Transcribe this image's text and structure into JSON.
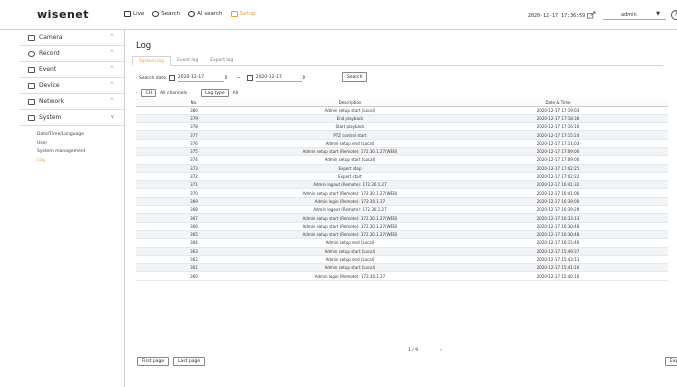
{
  "header": {
    "logo": "wisenet",
    "nav": [
      {
        "label": "Live",
        "icon": "monitor-icon"
      },
      {
        "label": "Search",
        "icon": "search-icon"
      },
      {
        "label": "AI search",
        "icon": "ai-search-icon"
      },
      {
        "label": "Setup",
        "icon": "setup-icon",
        "active": true
      }
    ],
    "datetime": "2020-12-17 17:36:59",
    "user": "admin",
    "help": "?"
  },
  "sidebar": {
    "items": [
      {
        "label": "Camera",
        "icon": "camera-icon"
      },
      {
        "label": "Record",
        "icon": "record-icon"
      },
      {
        "label": "Event",
        "icon": "event-icon"
      },
      {
        "label": "Device",
        "icon": "device-icon"
      },
      {
        "label": "Network",
        "icon": "network-icon"
      },
      {
        "label": "System",
        "icon": "system-icon"
      }
    ],
    "submenu": [
      "Date/Time/Language",
      "User",
      "System management",
      "Log"
    ]
  },
  "main": {
    "title": "Log",
    "tabs": [
      "System log",
      "Event log",
      "Export log"
    ],
    "filter": {
      "label": "Search date",
      "start_date": "2020-12-17",
      "end_date": "2020-12-17",
      "search_button": "Search"
    },
    "channel": {
      "ch_button": "CH",
      "ch_value": "All channels",
      "log_type_button": "Log type",
      "log_type_value": "All"
    },
    "table": {
      "headers": [
        "No.",
        "Description",
        "Date & Time"
      ],
      "rows": [
        [
          "380",
          "Admin setup start (Local)",
          "2020-12-17 17:19:03"
        ],
        [
          "379",
          "End playback",
          "2020-12-17 17:18:38"
        ],
        [
          "378",
          "Start playback",
          "2020-12-17 17:16:16"
        ],
        [
          "377",
          "PTZ control start",
          "2020-12-17 17:15:24"
        ],
        [
          "376",
          "Admin setup end (Local)",
          "2020-12-17 17:11:03"
        ],
        [
          "375",
          "Admin setup start (Remote): 172.30.1.27(WEB)",
          "2020-12-17 17:09:00"
        ],
        [
          "374",
          "Admin setup start (Local)",
          "2020-12-17 17:09:00"
        ],
        [
          "373",
          "Export stop",
          "2020-12-17 17:02:25"
        ],
        [
          "372",
          "Export start",
          "2020-12-17 17:02:22"
        ],
        [
          "371",
          "Admin logout (Remote): 172.30.1.27",
          "2020-12-17 16:41:32"
        ],
        [
          "370",
          "Admin setup start (Remote): 172.30.1.27(WEB)",
          "2020-12-17 16:41:06"
        ],
        [
          "369",
          "Admin login (Remote): 172.30.1.27",
          "2020-12-17 16:39:00"
        ],
        [
          "368",
          "Admin logout (Remote): 172.30.1.27",
          "2020-12-17 16:39:29"
        ],
        [
          "367",
          "Admin setup start (Remote): 172.30.1.27(WEB)",
          "2020-12-17 16:33:13"
        ],
        [
          "366",
          "Admin setup start (Remote): 172.30.1.27(WEB)",
          "2020-12-17 16:30:48"
        ],
        [
          "365",
          "Admin setup start (Remote): 172.30.1.27(WEB)",
          "2020-12-17 16:30:48"
        ],
        [
          "364",
          "Admin setup end (Local)",
          "2020-12-17 16:15:46"
        ],
        [
          "363",
          "Admin setup start (Local)",
          "2020-12-17 15:49:37"
        ],
        [
          "362",
          "Admin setup end (Local)",
          "2020-12-17 15:43:13"
        ],
        [
          "361",
          "Admin setup start (Local)",
          "2020-12-17 15:41:16"
        ],
        [
          "360",
          "Admin login (Remote): 172.30.1.27",
          "2020-12-17 15:40:16"
        ]
      ]
    },
    "pager": {
      "page": "1 / 9",
      "next": "›"
    },
    "first_page": "First page",
    "last_page": "Last page",
    "export": "Exp"
  }
}
